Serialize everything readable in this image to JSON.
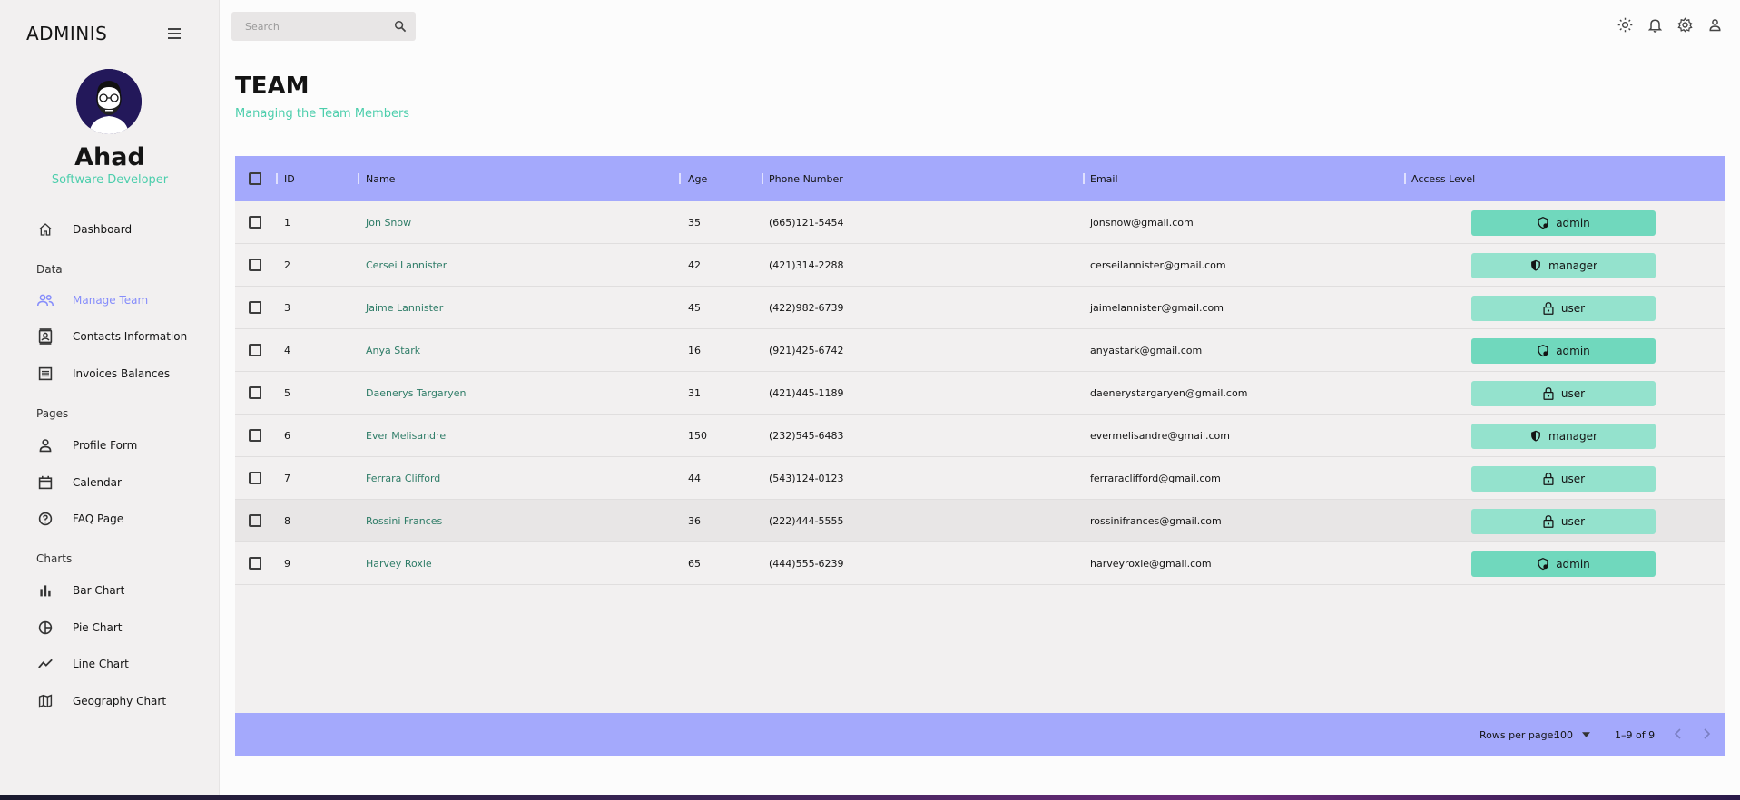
{
  "brand": "ADMINIS",
  "profile": {
    "name": "Ahad",
    "role": "Software Developer"
  },
  "search": {
    "placeholder": "Search"
  },
  "colors": {
    "accent_green": "#4cceac",
    "accent_blue": "#a4a9fc",
    "active_nav": "#868dfb",
    "admin": "#70d8bd",
    "manager": "#94e2cd",
    "user": "#94e2cd"
  },
  "nav": {
    "dashboard": {
      "label": "Dashboard",
      "icon": "home-icon"
    },
    "section_data": "Data",
    "manage_team": {
      "label": "Manage Team",
      "icon": "people-icon"
    },
    "contacts": {
      "label": "Contacts Information",
      "icon": "contacts-icon"
    },
    "invoices": {
      "label": "Invoices Balances",
      "icon": "receipt-icon"
    },
    "section_pages": "Pages",
    "profile_form": {
      "label": "Profile Form",
      "icon": "person-icon"
    },
    "calendar": {
      "label": "Calendar",
      "icon": "calendar-icon"
    },
    "faq": {
      "label": "FAQ Page",
      "icon": "help-icon"
    },
    "section_charts": "Charts",
    "bar": {
      "label": "Bar Chart",
      "icon": "bar-chart-icon"
    },
    "pie": {
      "label": "Pie Chart",
      "icon": "pie-chart-icon"
    },
    "line": {
      "label": "Line Chart",
      "icon": "timeline-icon"
    },
    "geo": {
      "label": "Geography Chart",
      "icon": "map-icon"
    }
  },
  "header": {
    "title": "TEAM",
    "subtitle": "Managing the Team Members"
  },
  "table": {
    "columns": {
      "id": "ID",
      "name": "Name",
      "age": "Age",
      "phone": "Phone Number",
      "email": "Email",
      "access": "Access Level"
    },
    "rows": [
      {
        "id": "1",
        "name": "Jon Snow",
        "age": "35",
        "phone": "(665)121-5454",
        "email": "jonsnow@gmail.com",
        "access": "admin"
      },
      {
        "id": "2",
        "name": "Cersei Lannister",
        "age": "42",
        "phone": "(421)314-2288",
        "email": "cerseilannister@gmail.com",
        "access": "manager"
      },
      {
        "id": "3",
        "name": "Jaime Lannister",
        "age": "45",
        "phone": "(422)982-6739",
        "email": "jaimelannister@gmail.com",
        "access": "user"
      },
      {
        "id": "4",
        "name": "Anya Stark",
        "age": "16",
        "phone": "(921)425-6742",
        "email": "anyastark@gmail.com",
        "access": "admin"
      },
      {
        "id": "5",
        "name": "Daenerys Targaryen",
        "age": "31",
        "phone": "(421)445-1189",
        "email": "daenerystargaryen@gmail.com",
        "access": "user"
      },
      {
        "id": "6",
        "name": "Ever Melisandre",
        "age": "150",
        "phone": "(232)545-6483",
        "email": "evermelisandre@gmail.com",
        "access": "manager"
      },
      {
        "id": "7",
        "name": "Ferrara Clifford",
        "age": "44",
        "phone": "(543)124-0123",
        "email": "ferraraclifford@gmail.com",
        "access": "user"
      },
      {
        "id": "8",
        "name": "Rossini Frances",
        "age": "36",
        "phone": "(222)444-5555",
        "email": "rossinifrances@gmail.com",
        "access": "user"
      },
      {
        "id": "9",
        "name": "Harvey Roxie",
        "age": "65",
        "phone": "(444)555-6239",
        "email": "harveyroxie@gmail.com",
        "access": "admin"
      }
    ]
  },
  "footer": {
    "rows_per_page_label": "Rows per page:",
    "rows_per_page_value": "100",
    "range": "1–9 of 9"
  }
}
